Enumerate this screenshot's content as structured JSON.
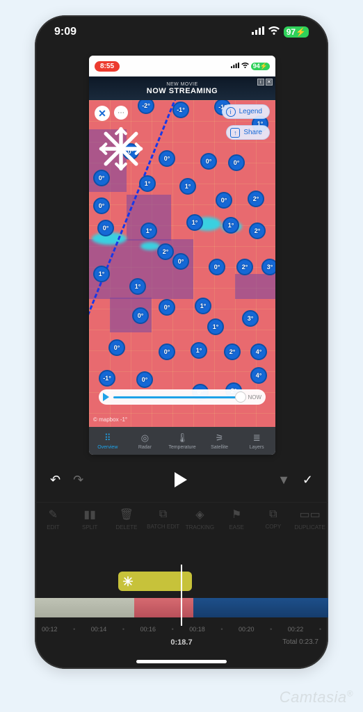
{
  "watermark": "Camtasia",
  "statusbar_outer": {
    "time": "9:09",
    "battery": "97"
  },
  "statusbar_inner": {
    "time": "8:55",
    "battery": "94"
  },
  "ad": {
    "sub": "NEW MOVIE",
    "main": "NOW STREAMING"
  },
  "map_buttons": {
    "legend": "Legend",
    "share": "Share"
  },
  "slider": {
    "now_label": "NOW"
  },
  "map_attrib": "© mapbox",
  "weather_nav": {
    "items": [
      {
        "label": "Overview",
        "active": true
      },
      {
        "label": "Radar"
      },
      {
        "label": "Temperature"
      },
      {
        "label": "Satellite"
      },
      {
        "label": "Layers"
      }
    ]
  },
  "toolbar": {
    "items": [
      "EDIT",
      "SPLIT",
      "DELETE",
      "BATCH EDIT",
      "TRACKING",
      "EASE",
      "COPY",
      "DUPLICATE"
    ]
  },
  "timeline": {
    "ticks": [
      "00:12",
      "00:14",
      "00:16",
      "00:18",
      "00:20",
      "00:22"
    ],
    "playhead": "0:18.7",
    "total_label": "Total 0:23.7"
  },
  "temps": {
    "d1": "0°",
    "d2": "0°",
    "d3": "0°",
    "d4": "0°",
    "d5": "0°",
    "d6": "1°",
    "d7": "0°",
    "d8": "1°",
    "d9": "1°",
    "d10": "0°",
    "d11": "2°",
    "d12": "0°",
    "d13": "1°",
    "d14": "2°",
    "d15": "1°",
    "d16": "1°",
    "d17": "2°",
    "d18": "1°",
    "d19": "1°",
    "d20": "0°",
    "d21": "0°",
    "d22": "2°",
    "d23": "3°",
    "d24": "0°",
    "d25": "0°",
    "d26": "1°",
    "d27": "1°",
    "d28": "3°",
    "d29": "0°",
    "d30": "0°",
    "d31": "1°",
    "d32": "2°",
    "d33": "4°",
    "d34": "-1°",
    "d35": "0°",
    "d36": "0°",
    "d37": "2°",
    "d38": "4°",
    "d39": "-2°",
    "d40": "-1°",
    "d41": "-1°"
  }
}
